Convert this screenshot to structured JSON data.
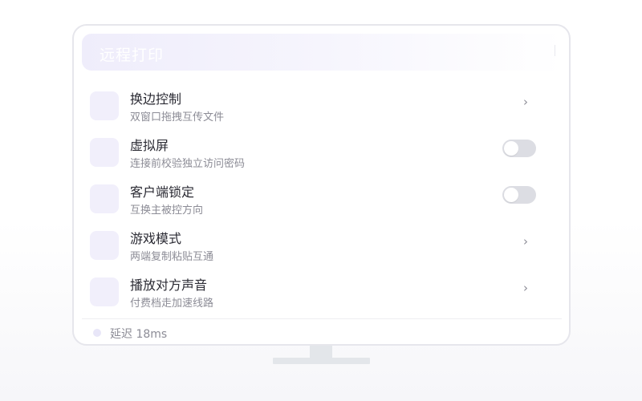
{
  "header": {
    "title": "远程打印"
  },
  "settings": {
    "items": [
      {
        "title": "换边控制",
        "subtitle": "双窗口拖拽互传文件",
        "control": "chevron",
        "chevron": "›"
      },
      {
        "title": "虚拟屏",
        "subtitle": "连接前校验独立访问密码",
        "control": "toggle",
        "on": false
      },
      {
        "title": "客户端锁定",
        "subtitle": "互换主被控方向",
        "control": "toggle",
        "on": false
      },
      {
        "title": "游戏模式",
        "subtitle": "两端复制粘贴互通",
        "control": "chevron",
        "chevron": "›"
      },
      {
        "title": "播放对方声音",
        "subtitle": "付费档走加速线路",
        "control": "chevron",
        "chevron": "›"
      }
    ]
  },
  "status": {
    "latency_text": "延迟 18ms"
  },
  "colors": {
    "accent_light": "#f1effb",
    "toggle_off": "#dcdde3",
    "text_primary": "#2a2a33",
    "text_secondary": "#8c8c96"
  }
}
